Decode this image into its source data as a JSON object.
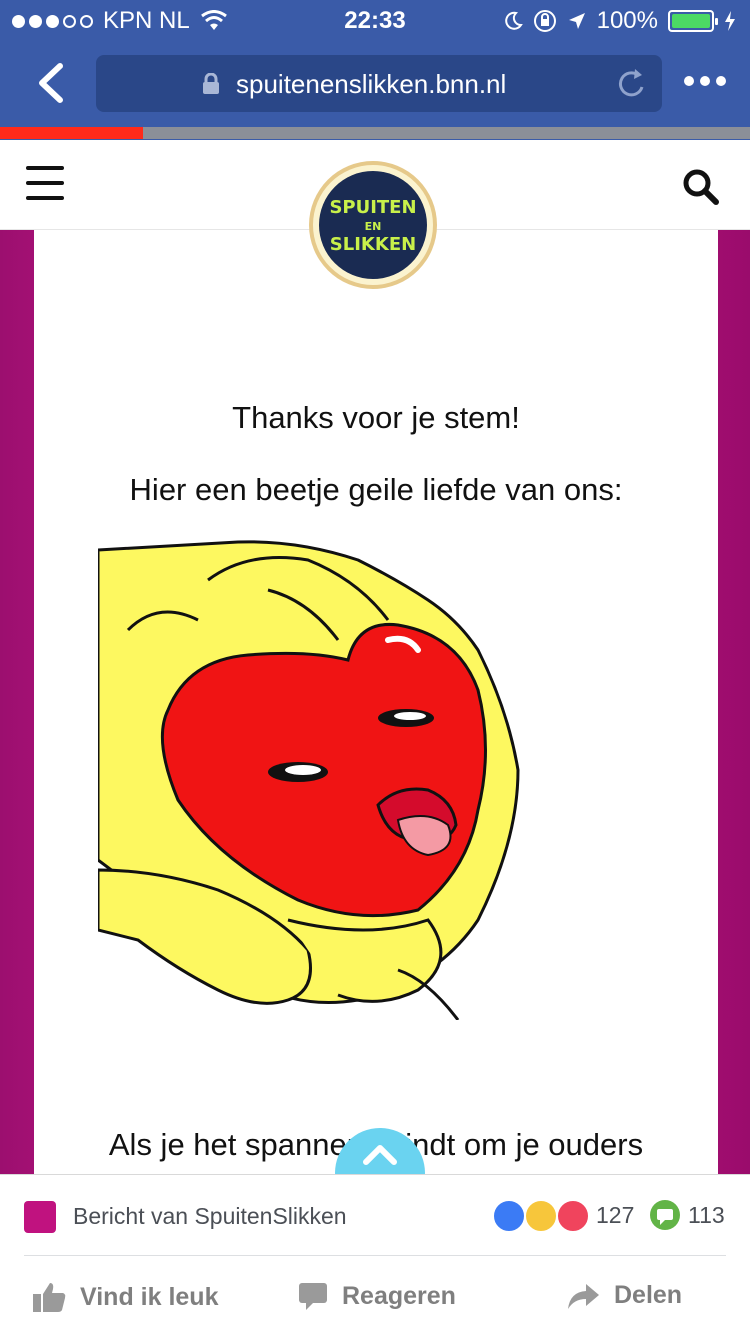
{
  "status_bar": {
    "carrier": "KPN NL",
    "time": "22:33",
    "battery": "100%"
  },
  "browser": {
    "url": "spuitenenslikken.bnn.nl",
    "load_progress": 0.19
  },
  "site": {
    "logo_top": "SPUITEN",
    "logo_mid": "EN",
    "logo_bottom": "SLIKKEN"
  },
  "content": {
    "line1": "Thanks voor je stem!",
    "line2": "Hier een beetje geile liefde van ons:",
    "line3": "Als je het spannend vindt om je ouders"
  },
  "facebook": {
    "message": "Bericht van SpuitenSlikken",
    "reaction_count": "127",
    "comment_count": "113",
    "like_label": "Vind ik leuk",
    "comment_label": "Reageren",
    "share_label": "Delen"
  },
  "colors": {
    "browser_blue": "#3a5ba8",
    "page_magenta": "#c0127f",
    "progress_red": "#ff2a1a",
    "fab_blue": "#6ad3f0"
  }
}
